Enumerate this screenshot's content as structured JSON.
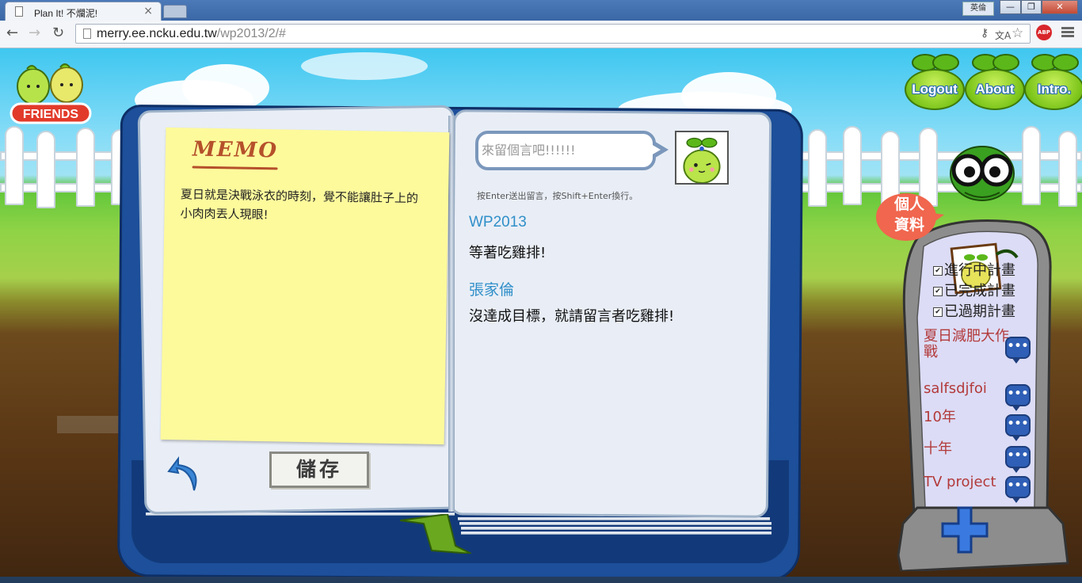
{
  "browser": {
    "tab_title": "Plan It! 不爛泥!",
    "tab_close": "×",
    "ime_badge": "英倫",
    "win_min": "—",
    "win_max": "❐",
    "win_close": "✕",
    "url_host": "merry.ee.ncku.edu.tw",
    "url_path": "/wp2013/2/#",
    "back": "←",
    "forward": "→",
    "reload": "↻",
    "key_icon": "⚷",
    "translate_icon": "文A",
    "star_icon": "☆",
    "abp_label": "ABP"
  },
  "header": {
    "logo_text": "FRIENDS",
    "nav": [
      {
        "label": "Logout"
      },
      {
        "label": "About"
      },
      {
        "label": "Intro."
      }
    ]
  },
  "memo": {
    "title": "MEMO",
    "text": "夏日就是決戰泳衣的時刻，覺不能讓肚子上的小肉肉丟人現眼!"
  },
  "save_label": "儲存",
  "comment": {
    "placeholder": "來留個言吧!!!!!!",
    "hint": "按Enter送出留言，按Shift+Enter換行。",
    "entries": [
      {
        "author": "WP2013",
        "text": "等著吃雞排!"
      },
      {
        "author": "張家倫",
        "text": "沒達成目標，就請留言者吃雞排!"
      }
    ]
  },
  "profile": {
    "bubble_line1": "個人",
    "bubble_line2": "資料",
    "filters": [
      {
        "label": "進行中計畫",
        "checked": true
      },
      {
        "label": "已完成計畫",
        "checked": true
      },
      {
        "label": "已過期計畫",
        "checked": true
      }
    ],
    "plans": [
      {
        "label": "夏日減肥大作戰"
      },
      {
        "label": "salfsdjfoi"
      },
      {
        "label": "10年"
      },
      {
        "label": "十年"
      },
      {
        "label": "TV project"
      }
    ],
    "chat_glyph": "•••",
    "check_glyph": "✔"
  },
  "colors": {
    "accent_blue": "#2f8fc9",
    "plan_red": "#b23a3a",
    "book_blue": "#1d4f9a",
    "memo_yellow": "#fdfa9c"
  }
}
